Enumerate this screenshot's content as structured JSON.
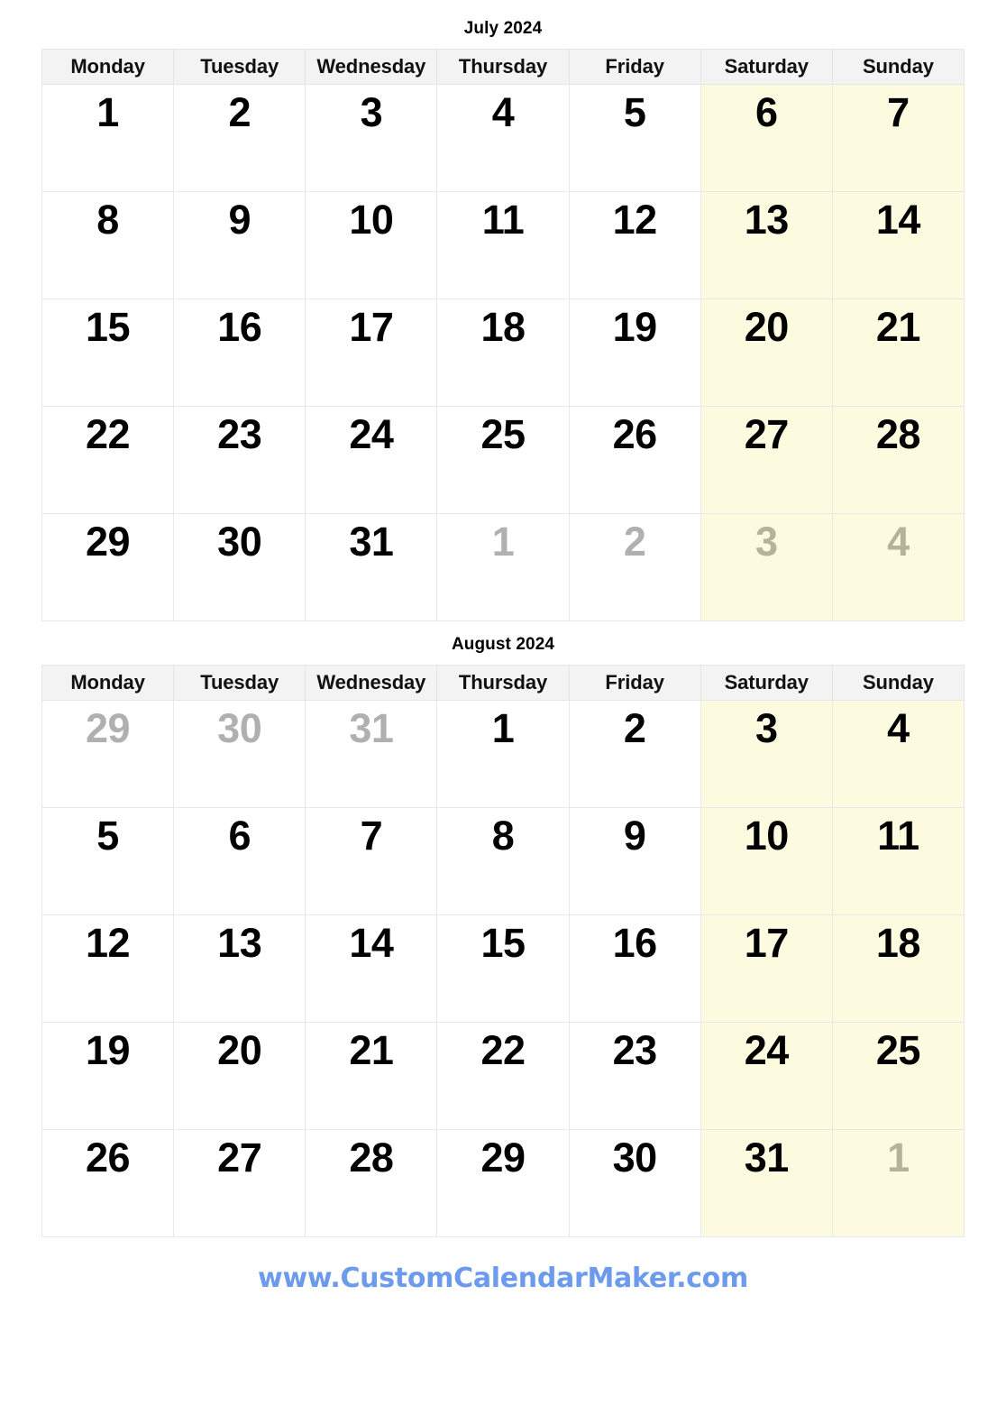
{
  "site": {
    "footer_link": "www.CustomCalendarMaker.com",
    "footer_link_color": "#6c9aec"
  },
  "style": {
    "weekend_cell_color": "#fcfbe0",
    "header_cell_color": "#f3f3f3",
    "grid_line_color": "#e8e8e8",
    "day_text_color": "#000000",
    "other_month_text_color": "#b0b0b0"
  },
  "weekday_headers": [
    "Monday",
    "Tuesday",
    "Wednesday",
    "Thursday",
    "Friday",
    "Saturday",
    "Sunday"
  ],
  "months": [
    {
      "title": "July 2024",
      "weeks": [
        [
          {
            "n": "1",
            "muted": false,
            "weekend": false
          },
          {
            "n": "2",
            "muted": false,
            "weekend": false
          },
          {
            "n": "3",
            "muted": false,
            "weekend": false
          },
          {
            "n": "4",
            "muted": false,
            "weekend": false
          },
          {
            "n": "5",
            "muted": false,
            "weekend": false
          },
          {
            "n": "6",
            "muted": false,
            "weekend": true
          },
          {
            "n": "7",
            "muted": false,
            "weekend": true
          }
        ],
        [
          {
            "n": "8",
            "muted": false,
            "weekend": false
          },
          {
            "n": "9",
            "muted": false,
            "weekend": false
          },
          {
            "n": "10",
            "muted": false,
            "weekend": false
          },
          {
            "n": "11",
            "muted": false,
            "weekend": false
          },
          {
            "n": "12",
            "muted": false,
            "weekend": false
          },
          {
            "n": "13",
            "muted": false,
            "weekend": true
          },
          {
            "n": "14",
            "muted": false,
            "weekend": true
          }
        ],
        [
          {
            "n": "15",
            "muted": false,
            "weekend": false
          },
          {
            "n": "16",
            "muted": false,
            "weekend": false
          },
          {
            "n": "17",
            "muted": false,
            "weekend": false
          },
          {
            "n": "18",
            "muted": false,
            "weekend": false
          },
          {
            "n": "19",
            "muted": false,
            "weekend": false
          },
          {
            "n": "20",
            "muted": false,
            "weekend": true
          },
          {
            "n": "21",
            "muted": false,
            "weekend": true
          }
        ],
        [
          {
            "n": "22",
            "muted": false,
            "weekend": false
          },
          {
            "n": "23",
            "muted": false,
            "weekend": false
          },
          {
            "n": "24",
            "muted": false,
            "weekend": false
          },
          {
            "n": "25",
            "muted": false,
            "weekend": false
          },
          {
            "n": "26",
            "muted": false,
            "weekend": false
          },
          {
            "n": "27",
            "muted": false,
            "weekend": true
          },
          {
            "n": "28",
            "muted": false,
            "weekend": true
          }
        ],
        [
          {
            "n": "29",
            "muted": false,
            "weekend": false
          },
          {
            "n": "30",
            "muted": false,
            "weekend": false
          },
          {
            "n": "31",
            "muted": false,
            "weekend": false
          },
          {
            "n": "1",
            "muted": true,
            "weekend": false
          },
          {
            "n": "2",
            "muted": true,
            "weekend": false
          },
          {
            "n": "3",
            "muted": true,
            "weekend": true
          },
          {
            "n": "4",
            "muted": true,
            "weekend": true
          }
        ]
      ]
    },
    {
      "title": "August 2024",
      "weeks": [
        [
          {
            "n": "29",
            "muted": true,
            "weekend": false
          },
          {
            "n": "30",
            "muted": true,
            "weekend": false
          },
          {
            "n": "31",
            "muted": true,
            "weekend": false
          },
          {
            "n": "1",
            "muted": false,
            "weekend": false
          },
          {
            "n": "2",
            "muted": false,
            "weekend": false
          },
          {
            "n": "3",
            "muted": false,
            "weekend": true
          },
          {
            "n": "4",
            "muted": false,
            "weekend": true
          }
        ],
        [
          {
            "n": "5",
            "muted": false,
            "weekend": false
          },
          {
            "n": "6",
            "muted": false,
            "weekend": false
          },
          {
            "n": "7",
            "muted": false,
            "weekend": false
          },
          {
            "n": "8",
            "muted": false,
            "weekend": false
          },
          {
            "n": "9",
            "muted": false,
            "weekend": false
          },
          {
            "n": "10",
            "muted": false,
            "weekend": true
          },
          {
            "n": "11",
            "muted": false,
            "weekend": true
          }
        ],
        [
          {
            "n": "12",
            "muted": false,
            "weekend": false
          },
          {
            "n": "13",
            "muted": false,
            "weekend": false
          },
          {
            "n": "14",
            "muted": false,
            "weekend": false
          },
          {
            "n": "15",
            "muted": false,
            "weekend": false
          },
          {
            "n": "16",
            "muted": false,
            "weekend": false
          },
          {
            "n": "17",
            "muted": false,
            "weekend": true
          },
          {
            "n": "18",
            "muted": false,
            "weekend": true
          }
        ],
        [
          {
            "n": "19",
            "muted": false,
            "weekend": false
          },
          {
            "n": "20",
            "muted": false,
            "weekend": false
          },
          {
            "n": "21",
            "muted": false,
            "weekend": false
          },
          {
            "n": "22",
            "muted": false,
            "weekend": false
          },
          {
            "n": "23",
            "muted": false,
            "weekend": false
          },
          {
            "n": "24",
            "muted": false,
            "weekend": true
          },
          {
            "n": "25",
            "muted": false,
            "weekend": true
          }
        ],
        [
          {
            "n": "26",
            "muted": false,
            "weekend": false
          },
          {
            "n": "27",
            "muted": false,
            "weekend": false
          },
          {
            "n": "28",
            "muted": false,
            "weekend": false
          },
          {
            "n": "29",
            "muted": false,
            "weekend": false
          },
          {
            "n": "30",
            "muted": false,
            "weekend": false
          },
          {
            "n": "31",
            "muted": false,
            "weekend": true
          },
          {
            "n": "1",
            "muted": true,
            "weekend": true
          }
        ]
      ]
    }
  ]
}
